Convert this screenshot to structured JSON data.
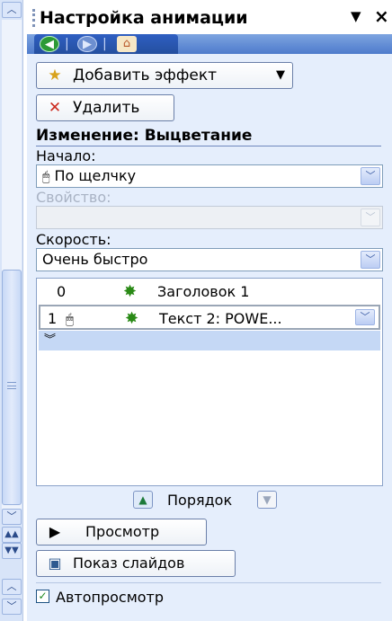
{
  "panel": {
    "title": "Настройка анимации",
    "title_dropdown_icon": "triangle-down-icon",
    "close_icon": "close-icon"
  },
  "nav": {
    "back_icon": "back-arrow-icon",
    "forward_icon": "forward-arrow-icon",
    "home_icon": "home-icon"
  },
  "toolbar": {
    "add_effect_label": "Добавить эффект",
    "delete_label": "Удалить"
  },
  "section": {
    "heading": "Изменение: Выцветание"
  },
  "start": {
    "label": "Начало:",
    "value": "По щелчку"
  },
  "property": {
    "label": "Свойство:",
    "value": ""
  },
  "speed": {
    "label": "Скорость:",
    "value": "Очень быстро"
  },
  "effects_list": {
    "items": [
      {
        "number": "0",
        "text": "Заголовок 1",
        "trigger_icon": "",
        "effect_icon": "star-icon"
      },
      {
        "number": "1",
        "text": "Текст 2: POWE...",
        "trigger_icon": "mouse-icon",
        "effect_icon": "star-icon"
      }
    ],
    "expand_icon": "double-chevron-down-icon"
  },
  "reorder": {
    "label": "Порядок",
    "up_icon": "arrow-up-icon",
    "down_icon": "arrow-down-icon"
  },
  "footer": {
    "play_label": "Просмотр",
    "slideshow_label": "Показ слайдов",
    "autopreview_label": "Автопросмотр",
    "autopreview_checked": true
  },
  "colors": {
    "pane_bg": "#e5eefc",
    "nav_bg": "#4e7bcc",
    "accent_green": "#2a8a16"
  }
}
